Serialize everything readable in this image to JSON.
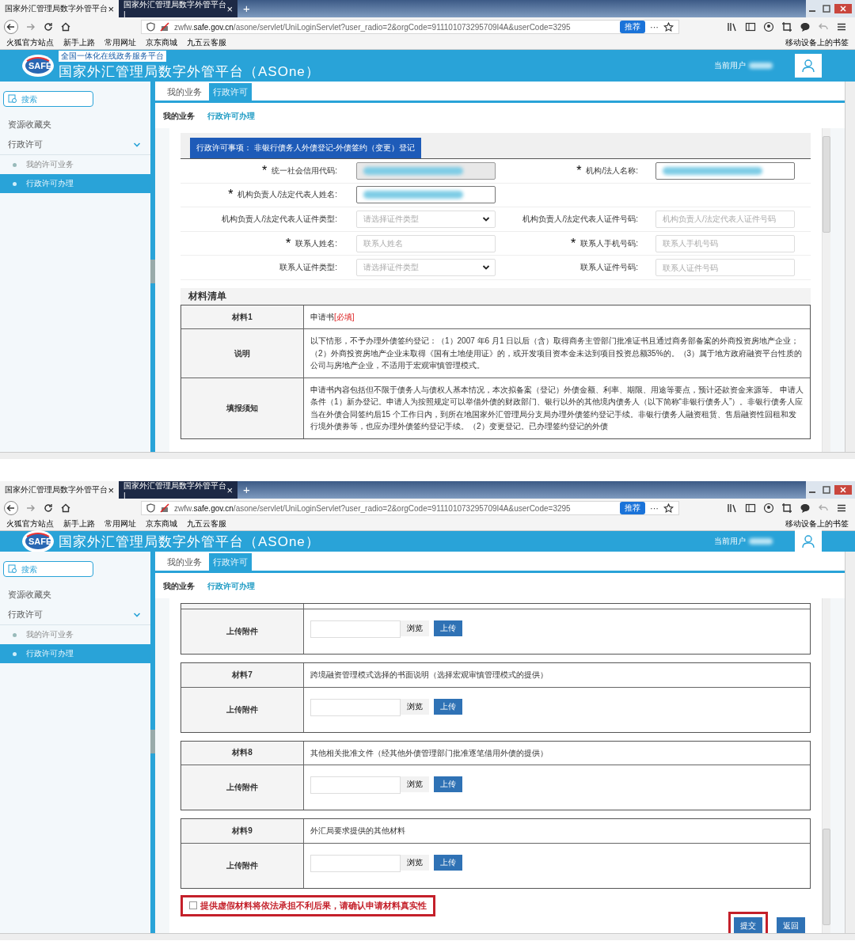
{
  "screens": [
    {
      "browser": {
        "tabs": [
          {
            "label": "国家外汇管理局数字外管平台",
            "close": "×",
            "selected": true
          },
          {
            "label": "国家外汇管理局数字外管平台 |",
            "close": "×",
            "selected": false
          }
        ],
        "new_tab": "+",
        "url_prefix": "zwfw.",
        "url_domain": "safe.gov.cn",
        "url_rest": "/asone/servlet/UniLoginServlet?user_radio=2&orgCode=911101073295709I4A&userCode=3295",
        "recommend": "推荐",
        "more": "···",
        "bookmarks": [
          "火狐官方站点",
          "新手上路",
          "常用网址",
          "京东商城",
          "九五云客服"
        ],
        "mobile_bookmarks": "移动设备上的书签"
      },
      "app": {
        "banner_label": "全国一体化在线政务服务平台",
        "logo_text": "SAFE",
        "title": "国家外汇管理局数字外管平台（ASOne）",
        "user_label": "当前用户",
        "search_placeholder": "搜索",
        "sidebar": [
          {
            "kind": "link",
            "label": "资源收藏夹"
          },
          {
            "kind": "group",
            "label": "行政许可",
            "expanded": true,
            "children": [
              {
                "label": "我的许可业务",
                "selected": false
              },
              {
                "label": "行政许可办理",
                "selected": true
              }
            ]
          }
        ],
        "tabs": [
          {
            "label": "我的业务",
            "selected": false
          },
          {
            "label": "行政许可",
            "selected": true
          }
        ],
        "breadcrumb": [
          {
            "label": "我的业务",
            "selected": false
          },
          {
            "label": "行政许可办理",
            "selected": true
          }
        ]
      },
      "content": {
        "kind": "form",
        "required_symbol": "*",
        "section_title": "行政许可事项：  非银行债务人外债登记-外债签约（变更）登记",
        "field_rows": [
          [
            {
              "label": "统一社会信用代码:",
              "required": true,
              "kind": "redacted",
              "disabled": true
            },
            {
              "label": "机构/法人名称:",
              "required": true,
              "kind": "redacted",
              "disabled": false
            }
          ],
          [
            {
              "label": "机构负责人/法定代表人姓名:",
              "required": true,
              "kind": "redacted",
              "disabled": false
            }
          ],
          [
            {
              "label": "机构负责人/法定代表人证件类型:",
              "required": false,
              "kind": "select",
              "placeholder": "请选择证件类型"
            },
            {
              "label": "机构负责人/法定代表人证件号码:",
              "required": false,
              "kind": "text",
              "placeholder": "机构负责人/法定代表人证件号码"
            }
          ],
          [
            {
              "label": "联系人姓名:",
              "required": true,
              "kind": "text",
              "placeholder": "联系人姓名"
            },
            {
              "label": "联系人手机号码:",
              "required": true,
              "kind": "text",
              "placeholder": "联系人手机号码"
            }
          ],
          [
            {
              "label": "联系人证件类型:",
              "required": false,
              "kind": "select",
              "placeholder": "请选择证件类型"
            },
            {
              "label": "联系人证件号码:",
              "required": false,
              "kind": "text",
              "placeholder": "联系人证件号码"
            }
          ]
        ],
        "materials_title": "材料清单",
        "materials": [
          {
            "rows": [
              {
                "kind": "text",
                "label": "材料1",
                "text": "申请书",
                "required_tag": "[必填]"
              },
              {
                "kind": "text",
                "label": "说明",
                "text": "以下情形，不予办理外债签约登记：（1）2007 年6 月1 日以后（含）取得商务主管部门批准证书且通过商务部备案的外商投资房地产企业；（2）外商投资房地产企业未取得《国有土地使用证》的，或开发项目资本金未达到项目投资总额35%的。（3）属于地方政府融资平台性质的公司与房地产企业，不适用于宏观审慎管理模式。"
              },
              {
                "kind": "text",
                "label": "填报须知",
                "text": "申请书内容包括但不限于债务人与债权人基本情况，本次拟备案（登记）外债金额、利率、期限、用途等要点，预计还款资金来源等。 申请人条件（1）新办登记。申请人为按照规定可以举借外债的财政部门、银行以外的其他境内债务人（以下简称“非银行债务人”）。非银行债务人应当在外债合同签约后15 个工作日内，到所在地国家外汇管理局分支局办理外债签约登记手续。非银行债务人融资租赁、售后融资性回租和发行境外债券等，也应办理外债签约登记手续。（2）变更登记。已办理签约登记的外债"
              }
            ]
          }
        ]
      }
    },
    {
      "browser": {
        "tabs": [
          {
            "label": "国家外汇管理局数字外管平台",
            "close": "×",
            "selected": true
          },
          {
            "label": "国家外汇管理局数字外管平台 |",
            "close": "×",
            "selected": false
          }
        ],
        "new_tab": "+",
        "url_prefix": "zwfw.",
        "url_domain": "safe.gov.cn",
        "url_rest": "/asone/servlet/UniLoginServlet?user_radio=2&orgCode=911101073295709I4A&userCode=3295",
        "recommend": "推荐",
        "more": "···",
        "bookmarks": [
          "火狐官方站点",
          "新手上路",
          "常用网址",
          "京东商城",
          "九五云客服"
        ],
        "mobile_bookmarks": "移动设备上的书签"
      },
      "app": {
        "logo_text": "SAFE",
        "title": "国家外汇管理局数字外管平台（ASOne）",
        "user_label": "当前用户",
        "search_placeholder": "搜索",
        "sidebar": [
          {
            "kind": "link",
            "label": "资源收藏夹"
          },
          {
            "kind": "group",
            "label": "行政许可",
            "expanded": true,
            "children": [
              {
                "label": "我的许可业务",
                "selected": false
              },
              {
                "label": "行政许可办理",
                "selected": true
              }
            ]
          }
        ],
        "tabs": [
          {
            "label": "我的业务",
            "selected": false
          },
          {
            "label": "行政许可",
            "selected": true
          }
        ],
        "breadcrumb": [
          {
            "label": "我的业务",
            "selected": false
          },
          {
            "label": "行政许可办理",
            "selected": true
          }
        ]
      },
      "content": {
        "kind": "uploads",
        "materials": [
          {
            "rows": [
              {
                "kind": "cut"
              },
              {
                "kind": "upload",
                "label": "上传附件",
                "browse": "浏览",
                "upload": "上传"
              }
            ]
          },
          {
            "rows": [
              {
                "kind": "text",
                "label": "材料7",
                "text": "跨境融资管理模式选择的书面说明（选择宏观审慎管理模式的提供）"
              },
              {
                "kind": "upload",
                "label": "上传附件",
                "browse": "浏览",
                "upload": "上传"
              }
            ]
          },
          {
            "rows": [
              {
                "kind": "text",
                "label": "材料8",
                "text": "其他相关批准文件（经其他外债管理部门批准逐笔借用外债的提供）"
              },
              {
                "kind": "upload",
                "label": "上传附件",
                "browse": "浏览",
                "upload": "上传"
              }
            ]
          },
          {
            "rows": [
              {
                "kind": "text",
                "label": "材料9",
                "text": "外汇局要求提供的其他材料"
              },
              {
                "kind": "upload",
                "label": "上传附件",
                "browse": "浏览",
                "upload": "上传"
              }
            ]
          }
        ],
        "confirm": {
          "checked": false,
          "text": "提供虚假材料将依法承担不利后果，请确认申请材料真实性"
        },
        "buttons": [
          {
            "label": "提交",
            "highlighted": true
          },
          {
            "label": "返回",
            "highlighted": false
          }
        ]
      }
    }
  ]
}
